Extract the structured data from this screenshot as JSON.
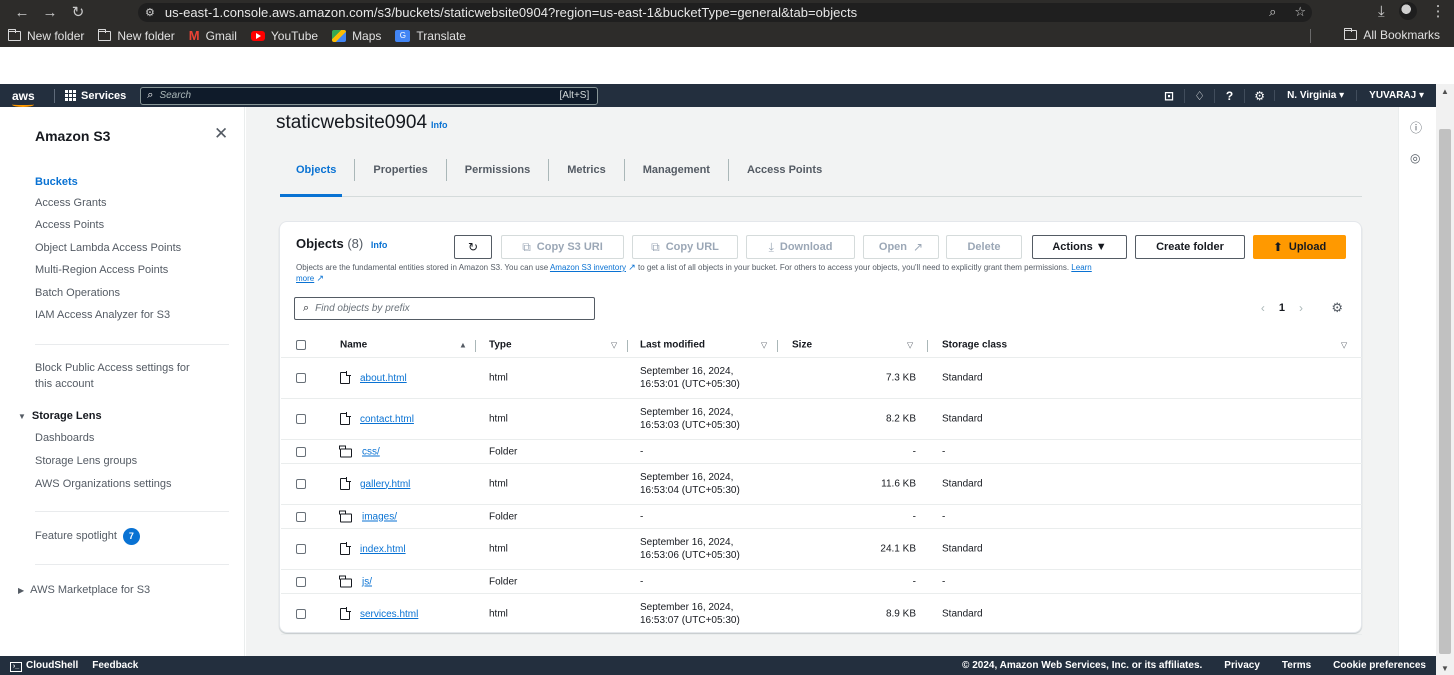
{
  "browser": {
    "url": "us-east-1.console.aws.amazon.com/s3/buckets/staticwebsite0904?region=us-east-1&bucketType=general&tab=objects",
    "bookmarks": [
      "New folder",
      "New folder",
      "Gmail",
      "YouTube",
      "Maps",
      "Translate"
    ],
    "all_bookmarks": "All Bookmarks"
  },
  "topnav": {
    "logo": "aws",
    "services": "Services",
    "search_placeholder": "Search",
    "search_shortcut": "[Alt+S]",
    "region": "N. Virginia ▾",
    "user": "YUVARAJ ▾"
  },
  "sidebar": {
    "title": "Amazon S3",
    "items": [
      {
        "label": "Buckets",
        "active": true
      },
      {
        "label": "Access Grants"
      },
      {
        "label": "Access Points"
      },
      {
        "label": "Object Lambda Access Points"
      },
      {
        "label": "Multi-Region Access Points"
      },
      {
        "label": "Batch Operations"
      },
      {
        "label": "IAM Access Analyzer for S3"
      }
    ],
    "block_public_line1": "Block Public Access settings for",
    "block_public_line2": "this account",
    "storage_lens": "Storage Lens",
    "storage_lens_items": [
      "Dashboards",
      "Storage Lens groups",
      "AWS Organizations settings"
    ],
    "feature_spotlight": "Feature spotlight",
    "feature_spotlight_count": "7",
    "marketplace": "AWS Marketplace for S3"
  },
  "main": {
    "title": "staticwebsite0904",
    "info": "Info",
    "tabs": [
      "Objects",
      "Properties",
      "Permissions",
      "Metrics",
      "Management",
      "Access Points"
    ],
    "active_tab": "Objects"
  },
  "objects_panel": {
    "title": "Objects",
    "count": "(8)",
    "info": "Info",
    "buttons": {
      "copy_s3_uri": "Copy S3 URI",
      "copy_url": "Copy URL",
      "download": "Download",
      "open": "Open",
      "delete": "Delete",
      "actions": "Actions ▼",
      "create_folder": "Create folder",
      "upload": "Upload"
    },
    "desc_1": "Objects are the fundamental entities stored in Amazon S3. You can use ",
    "desc_link": "Amazon S3 inventory",
    "desc_2": " to get a list of all objects in your bucket. For others to access your objects, you'll need to explicitly grant them permissions. ",
    "desc_learn": "Learn",
    "desc_more": "more",
    "filter_placeholder": "Find objects by prefix",
    "page": "1",
    "columns": [
      "Name",
      "Type",
      "Last modified",
      "Size",
      "Storage class"
    ],
    "rows": [
      {
        "name": "about.html",
        "kind": "file",
        "type": "html",
        "modified_1": "September 16, 2024,",
        "modified_2": "16:53:01 (UTC+05:30)",
        "size": "7.3 KB",
        "class": "Standard"
      },
      {
        "name": "contact.html",
        "kind": "file",
        "type": "html",
        "modified_1": "September 16, 2024,",
        "modified_2": "16:53:03 (UTC+05:30)",
        "size": "8.2 KB",
        "class": "Standard"
      },
      {
        "name": "css/",
        "kind": "folder",
        "type": "Folder",
        "modified_1": "-",
        "modified_2": "",
        "size": "-",
        "class": "-"
      },
      {
        "name": "gallery.html",
        "kind": "file",
        "type": "html",
        "modified_1": "September 16, 2024,",
        "modified_2": "16:53:04 (UTC+05:30)",
        "size": "11.6 KB",
        "class": "Standard"
      },
      {
        "name": "images/",
        "kind": "folder",
        "type": "Folder",
        "modified_1": "-",
        "modified_2": "",
        "size": "-",
        "class": "-"
      },
      {
        "name": "index.html",
        "kind": "file",
        "type": "html",
        "modified_1": "September 16, 2024,",
        "modified_2": "16:53:06 (UTC+05:30)",
        "size": "24.1 KB",
        "class": "Standard"
      },
      {
        "name": "js/",
        "kind": "folder",
        "type": "Folder",
        "modified_1": "-",
        "modified_2": "",
        "size": "-",
        "class": "-"
      },
      {
        "name": "services.html",
        "kind": "file",
        "type": "html",
        "modified_1": "September 16, 2024,",
        "modified_2": "16:53:07 (UTC+05:30)",
        "size": "8.9 KB",
        "class": "Standard"
      }
    ]
  },
  "footer": {
    "cloudshell": "CloudShell",
    "feedback": "Feedback",
    "copyright": "© 2024, Amazon Web Services, Inc. or its affiliates.",
    "privacy": "Privacy",
    "terms": "Terms",
    "cookies": "Cookie preferences"
  },
  "colors": {
    "accent": "#0972d3",
    "upload": "#ff9900",
    "nav_bg": "#232f3e"
  },
  "icons": [
    "back-icon",
    "forward-icon",
    "reload-icon",
    "search-icon",
    "star-icon",
    "download-icon",
    "close-icon",
    "refresh-icon",
    "copy-icon",
    "settings-icon",
    "file-icon",
    "folder-icon"
  ]
}
